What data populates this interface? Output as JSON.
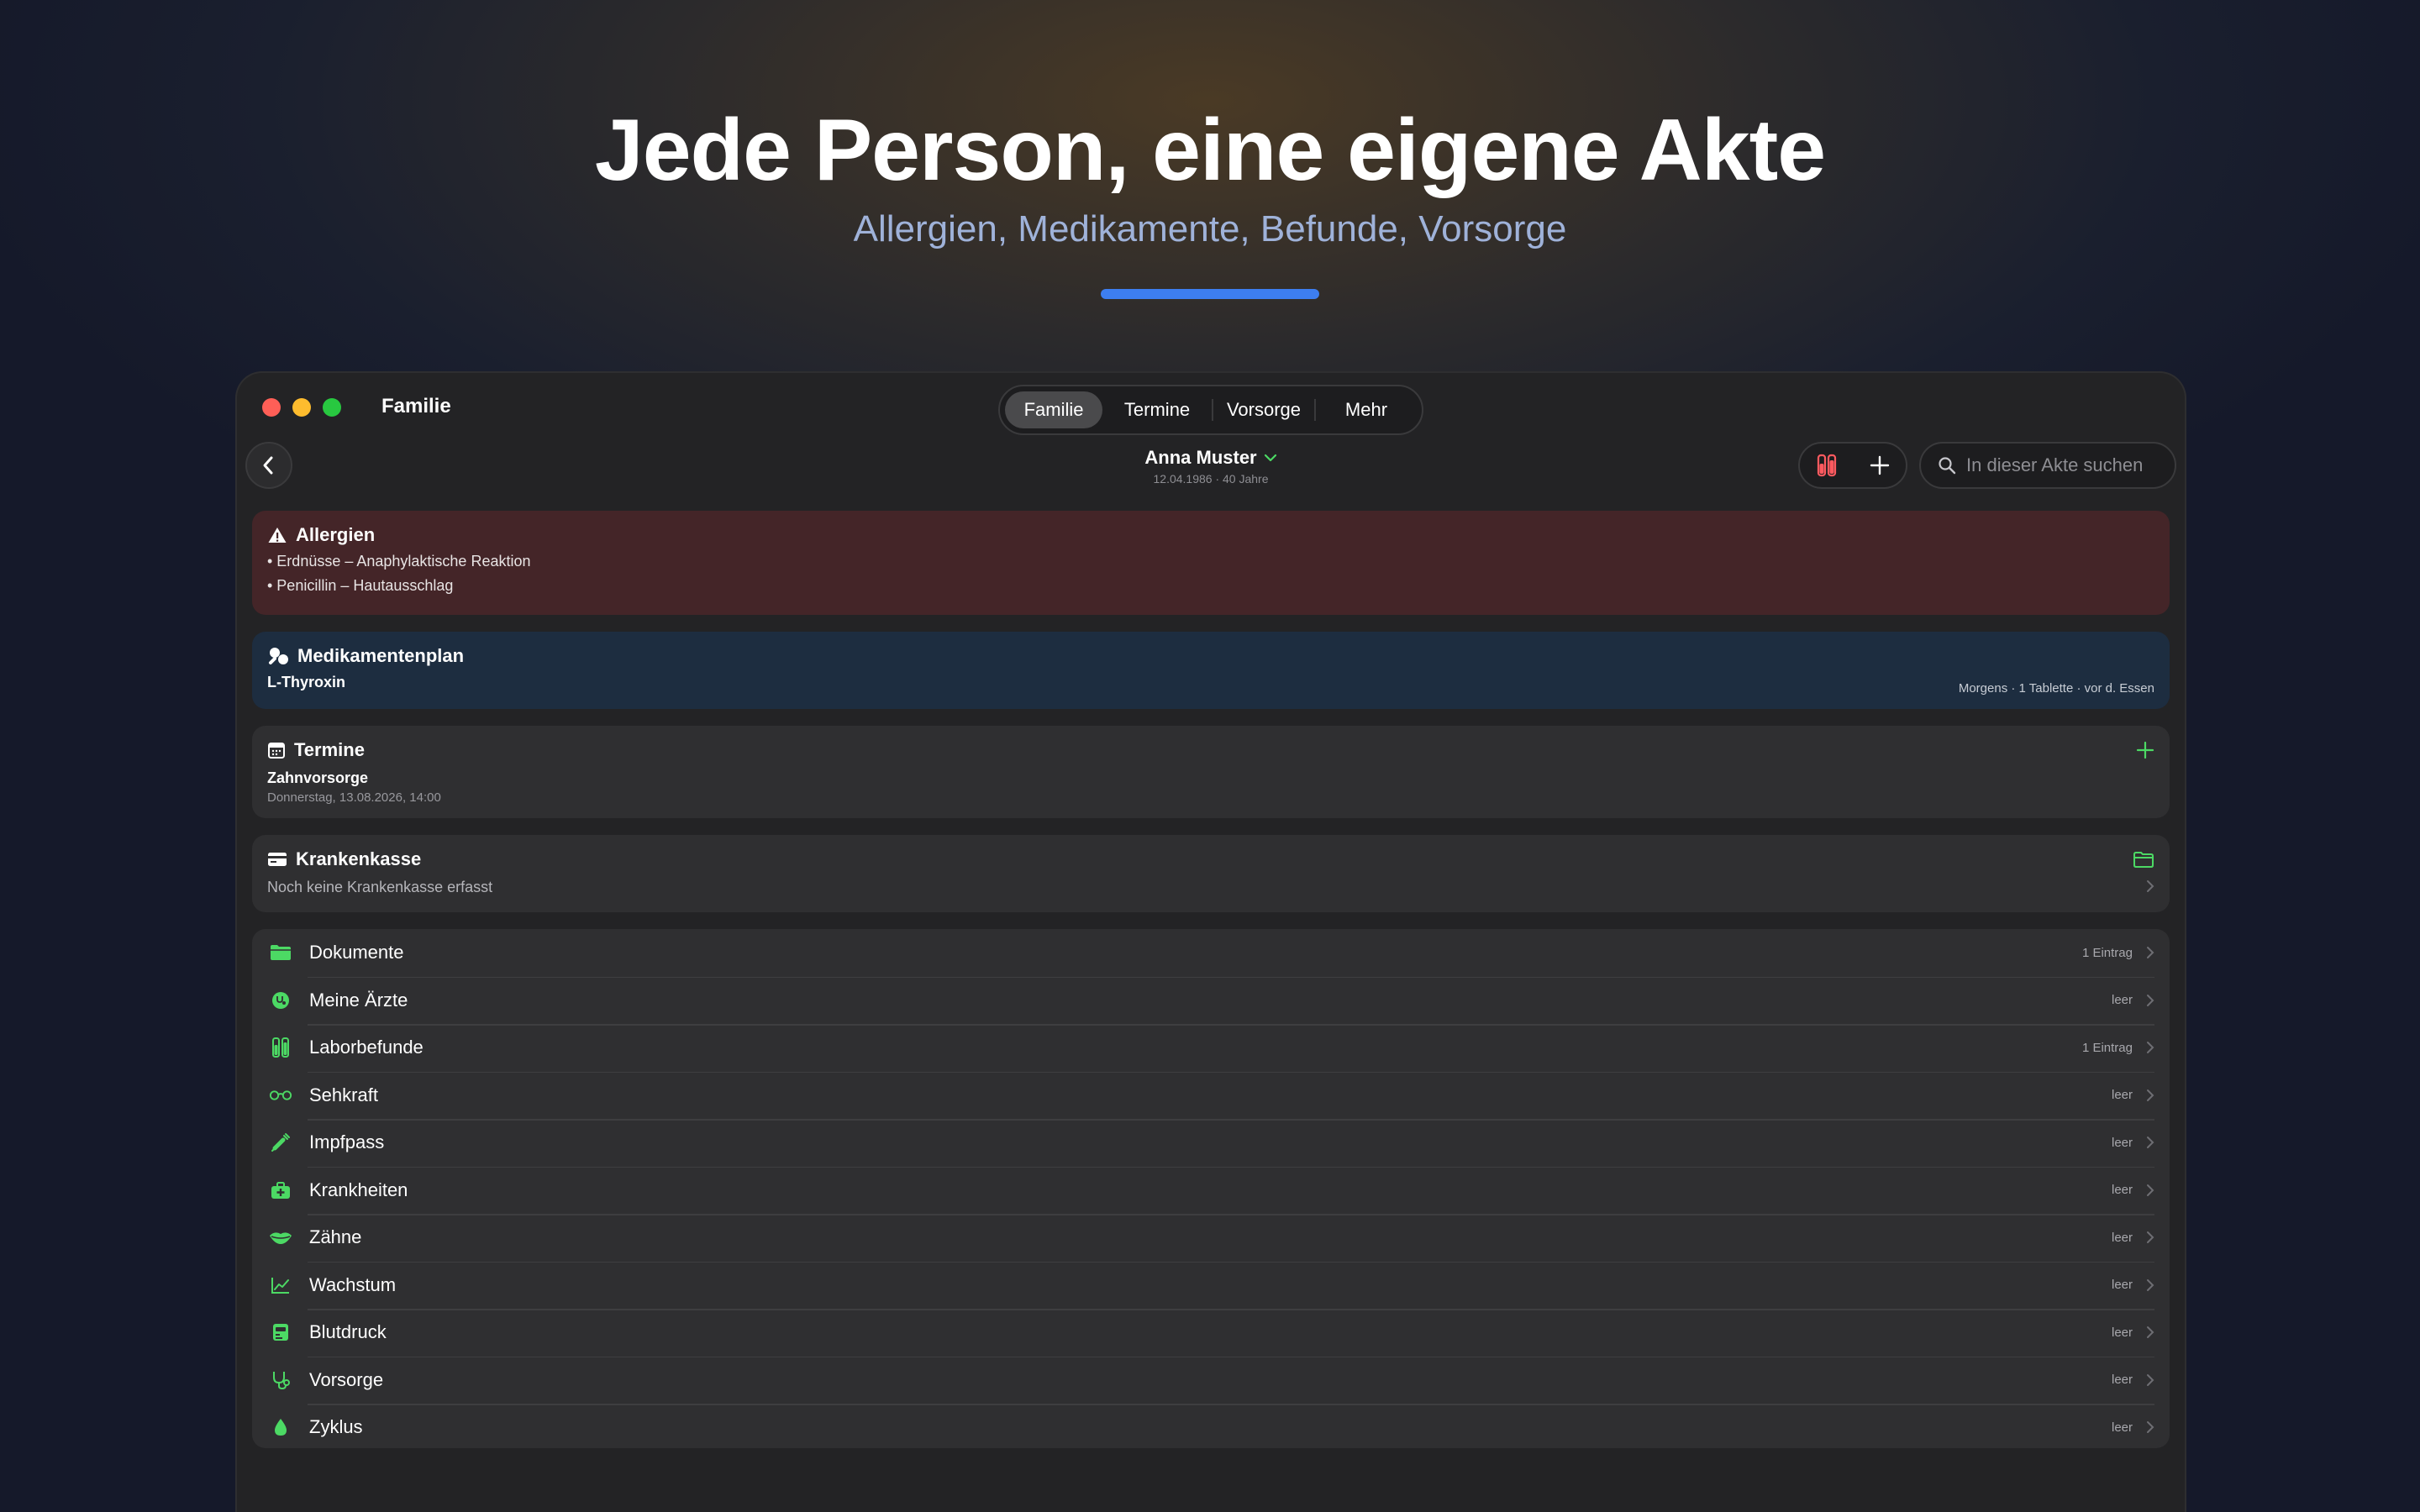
{
  "hero": {
    "title": "Jede Person, eine eigene Akte",
    "subtitle": "Allergien, Medikamente, Befunde, Vorsorge"
  },
  "window": {
    "title": "Familie",
    "tabs": [
      {
        "label": "Familie",
        "active": true
      },
      {
        "label": "Termine",
        "active": false
      },
      {
        "label": "Vorsorge",
        "active": false
      },
      {
        "label": "Mehr",
        "active": false
      }
    ]
  },
  "person": {
    "name": "Anna Muster",
    "details": "12.04.1986 · 40 Jahre"
  },
  "search": {
    "placeholder": "In dieser Akte suchen"
  },
  "allergies": {
    "heading": "Allergien",
    "items": [
      "• Erdnüsse – Anaphylaktische Reaktion",
      "• Penicillin – Hautausschlag"
    ]
  },
  "medication": {
    "heading": "Medikamentenplan",
    "name": "L-Thyroxin",
    "detail": "Morgens · 1 Tablette · vor d. Essen"
  },
  "appointments": {
    "heading": "Termine",
    "title": "Zahnvorsorge",
    "date": "Donnerstag, 13.08.2026, 14:00"
  },
  "insurance": {
    "heading": "Krankenkasse",
    "text": "Noch keine Krankenkasse erfasst"
  },
  "sections": [
    {
      "label": "Dokumente",
      "count": "1 Eintrag",
      "icon": "folder-icon"
    },
    {
      "label": "Meine Ärzte",
      "count": "leer",
      "icon": "stethoscope-icon"
    },
    {
      "label": "Laborbefunde",
      "count": "1 Eintrag",
      "icon": "test-tubes-icon"
    },
    {
      "label": "Sehkraft",
      "count": "leer",
      "icon": "glasses-icon"
    },
    {
      "label": "Impfpass",
      "count": "leer",
      "icon": "syringe-icon"
    },
    {
      "label": "Krankheiten",
      "count": "leer",
      "icon": "medical-bag-icon"
    },
    {
      "label": "Zähne",
      "count": "leer",
      "icon": "mouth-icon"
    },
    {
      "label": "Wachstum",
      "count": "leer",
      "icon": "growth-chart-icon"
    },
    {
      "label": "Blutdruck",
      "count": "leer",
      "icon": "blood-pressure-icon"
    },
    {
      "label": "Vorsorge",
      "count": "leer",
      "icon": "stethoscope-icon"
    },
    {
      "label": "Zyklus",
      "count": "leer",
      "icon": "drop-icon"
    }
  ],
  "colors": {
    "accent_green": "#4cd964",
    "accent_blue": "#3d7ef0",
    "allergy_bg": "#442528",
    "medication_bg": "#1d2d40",
    "lab_red": "#ff5a5f"
  }
}
